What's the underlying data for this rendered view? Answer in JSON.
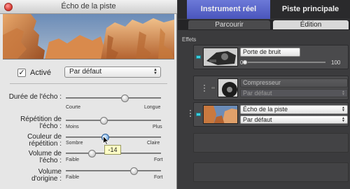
{
  "echo_window": {
    "title": "Écho de la piste",
    "active_label": "Activé",
    "active_checked": true,
    "preset_value": "Par défaut",
    "params": [
      {
        "label_lines": [
          "Durée de l'écho :"
        ],
        "left": "Courte",
        "right": "Longue",
        "value": 0.62
      },
      {
        "label_lines": [
          "Répétition de",
          "l'écho :"
        ],
        "left": "Moins",
        "right": "Plus",
        "value": 0.4
      },
      {
        "label_lines": [
          "Couleur de",
          "répétition :"
        ],
        "left": "Sombre",
        "right": "Claire",
        "value": 0.41
      },
      {
        "label_lines": [
          "Volume de",
          "l'écho :"
        ],
        "left": "Faible",
        "right": "Fort",
        "value": 0.27
      },
      {
        "label_lines": [
          "Volume",
          "d'origine :"
        ],
        "left": "Faible",
        "right": "Fort",
        "value": 0.71
      }
    ],
    "tooltip": "-14"
  },
  "right_panel": {
    "tabs": [
      "Instrument réel",
      "Piste principale"
    ],
    "subtabs": [
      "Parcourir",
      "Édition"
    ],
    "effects_label": "Effets",
    "effects": [
      {
        "name": "Porte de bruit",
        "enabled": true,
        "slider_value": 0,
        "min_label": "0",
        "max_label": "100"
      },
      {
        "name": "Compresseur",
        "enabled": false,
        "preset": "Par défaut"
      },
      {
        "name": "Écho de la piste",
        "enabled": true,
        "preset": "Par défaut"
      }
    ]
  }
}
